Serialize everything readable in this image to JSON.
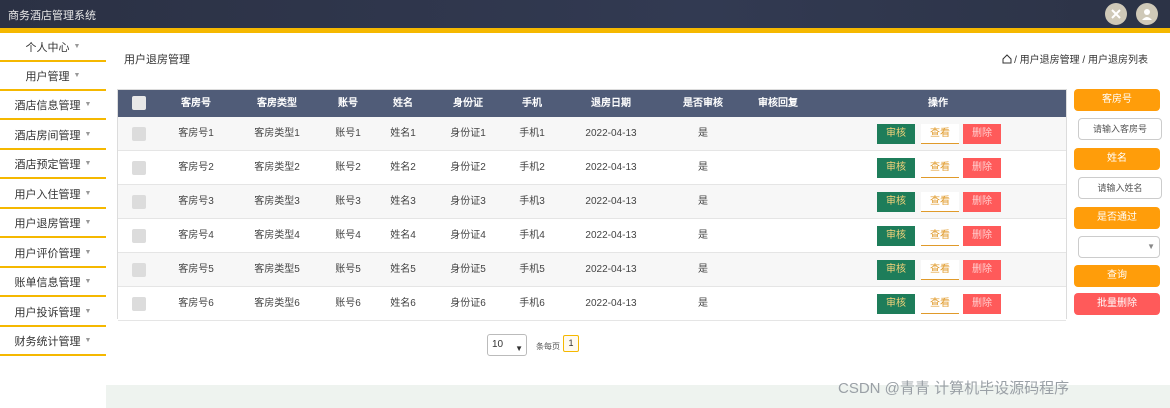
{
  "app": {
    "title": "商务酒店管理系统"
  },
  "sidebar": {
    "items": [
      {
        "label": "个人中心"
      },
      {
        "label": "用户管理"
      },
      {
        "label": "酒店信息管理"
      },
      {
        "label": "酒店房间管理"
      },
      {
        "label": "酒店预定管理"
      },
      {
        "label": "用户入住管理"
      },
      {
        "label": "用户退房管理"
      },
      {
        "label": "用户评价管理"
      },
      {
        "label": "账单信息管理"
      },
      {
        "label": "用户投诉管理"
      },
      {
        "label": "财务统计管理"
      }
    ]
  },
  "page": {
    "title": "用户退房管理",
    "breadcrumb": "/ 用户退房管理 / 用户退房列表"
  },
  "table": {
    "headers": [
      "客房号",
      "客房类型",
      "账号",
      "姓名",
      "身份证",
      "手机",
      "退房日期",
      "是否审核",
      "审核回复",
      "操作"
    ],
    "rows": [
      {
        "room": "客房号1",
        "type": "客房类型1",
        "account": "账号1",
        "name": "姓名1",
        "id": "身份证1",
        "phone": "手机1",
        "date": "2022-04-13",
        "audit": "是",
        "reply": ""
      },
      {
        "room": "客房号2",
        "type": "客房类型2",
        "account": "账号2",
        "name": "姓名2",
        "id": "身份证2",
        "phone": "手机2",
        "date": "2022-04-13",
        "audit": "是",
        "reply": ""
      },
      {
        "room": "客房号3",
        "type": "客房类型3",
        "account": "账号3",
        "name": "姓名3",
        "id": "身份证3",
        "phone": "手机3",
        "date": "2022-04-13",
        "audit": "是",
        "reply": ""
      },
      {
        "room": "客房号4",
        "type": "客房类型4",
        "account": "账号4",
        "name": "姓名4",
        "id": "身份证4",
        "phone": "手机4",
        "date": "2022-04-13",
        "audit": "是",
        "reply": ""
      },
      {
        "room": "客房号5",
        "type": "客房类型5",
        "account": "账号5",
        "name": "姓名5",
        "id": "身份证5",
        "phone": "手机5",
        "date": "2022-04-13",
        "audit": "是",
        "reply": ""
      },
      {
        "room": "客房号6",
        "type": "客房类型6",
        "account": "账号6",
        "name": "姓名6",
        "id": "身份证6",
        "phone": "手机6",
        "date": "2022-04-13",
        "audit": "是",
        "reply": ""
      }
    ],
    "actions": {
      "audit": "审核",
      "view": "查看",
      "delete": "删除"
    }
  },
  "search": {
    "room_label": "客房号",
    "room_placeholder": "请输入客房号",
    "name_label": "姓名",
    "name_placeholder": "请输入姓名",
    "audit_label": "是否通过",
    "audit_value": "",
    "query_button": "查询",
    "batch_delete_button": "批量删除"
  },
  "pagination": {
    "page_size": "10",
    "page_size_label": "条每页",
    "current_page": "1"
  },
  "watermark": "CSDN @青青  计算机毕设源码程序",
  "colors": {
    "header_bg": "#2b3144",
    "accent": "#f5b800",
    "table_head": "#505c78",
    "orange": "#ff9d0a",
    "audit_green": "#1e7d5a",
    "delete_red": "#ff5a5a"
  }
}
